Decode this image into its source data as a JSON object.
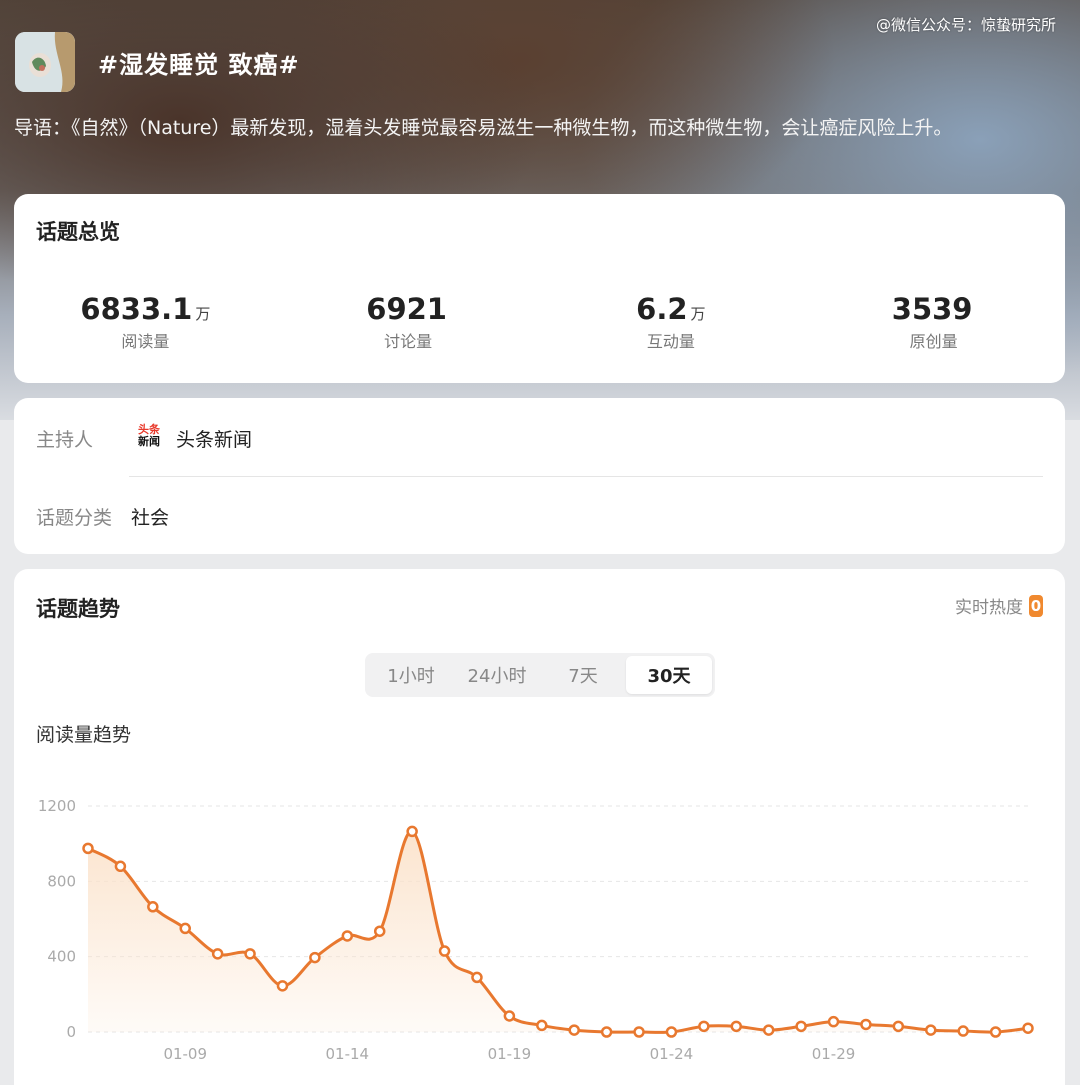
{
  "watermark": "@微信公众号：惊蛰研究所",
  "topic": {
    "title": "#湿发睡觉 致癌#",
    "intro": "导语：《自然》（Nature）最新发现，湿着头发睡觉最容易滋生一种微生物，而这种微生物，会让癌症风险上升。"
  },
  "overview": {
    "title": "话题总览",
    "stats": [
      {
        "value": "6833.1",
        "unit": "万",
        "label": "阅读量"
      },
      {
        "value": "6921",
        "unit": "",
        "label": "讨论量"
      },
      {
        "value": "6.2",
        "unit": "万",
        "label": "互动量"
      },
      {
        "value": "3539",
        "unit": "",
        "label": "原创量"
      }
    ]
  },
  "info": {
    "host_label": "主持人",
    "host_logo_line1": "头条",
    "host_logo_line2": "新闻",
    "host_name": "头条新闻",
    "category_label": "话题分类",
    "category_value": "社会"
  },
  "trend": {
    "title": "话题趋势",
    "realtime_label": "实时热度",
    "realtime_value": "0",
    "tabs": [
      "1小时",
      "24小时",
      "7天",
      "30天"
    ],
    "active_tab": "30天",
    "chart_title": "阅读量趋势"
  },
  "colors": {
    "accent": "#e8782f",
    "fill": "#fbe3cc"
  },
  "chart_data": {
    "type": "area",
    "title": "阅读量趋势",
    "x_ticks": [
      "01-09",
      "01-14",
      "01-19",
      "01-24",
      "01-29"
    ],
    "x": [
      "01-06",
      "01-07",
      "01-08",
      "01-09",
      "01-10",
      "01-11",
      "01-12",
      "01-13",
      "01-14",
      "01-15",
      "01-16",
      "01-17",
      "01-18",
      "01-19",
      "01-20",
      "01-21",
      "01-22",
      "01-23",
      "01-24",
      "01-25",
      "01-26",
      "01-27",
      "01-28",
      "01-29",
      "01-30",
      "01-31",
      "02-01",
      "02-02",
      "02-03",
      "02-04"
    ],
    "values": [
      975,
      880,
      665,
      550,
      415,
      415,
      245,
      395,
      510,
      535,
      1065,
      430,
      290,
      85,
      35,
      10,
      0,
      0,
      0,
      30,
      30,
      10,
      30,
      55,
      40,
      30,
      10,
      5,
      0,
      20
    ],
    "y_ticks": [
      0,
      400,
      800,
      1200
    ],
    "ylim": [
      0,
      1200
    ],
    "grid": true
  }
}
